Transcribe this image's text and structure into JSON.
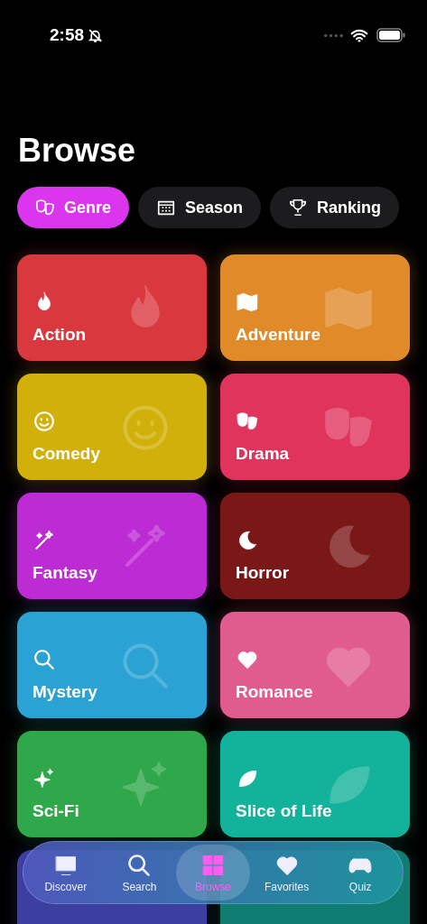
{
  "status_bar": {
    "time": "2:58"
  },
  "title": "Browse",
  "segments": [
    {
      "label": "Genre",
      "selected": true
    },
    {
      "label": "Season",
      "selected": false
    },
    {
      "label": "Ranking",
      "selected": false
    }
  ],
  "genres": [
    {
      "label": "Action",
      "color": "#d9383e"
    },
    {
      "label": "Adventure",
      "color": "#e08a2a"
    },
    {
      "label": "Comedy",
      "color": "#d2b00a"
    },
    {
      "label": "Drama",
      "color": "#e0345c"
    },
    {
      "label": "Fantasy",
      "color": "#bd2bd4"
    },
    {
      "label": "Horror",
      "color": "#7a1818"
    },
    {
      "label": "Mystery",
      "color": "#2aa3d4"
    },
    {
      "label": "Romance",
      "color": "#e05c8e"
    },
    {
      "label": "Sci-Fi",
      "color": "#2ea84a"
    },
    {
      "label": "Slice of Life",
      "color": "#12b39a"
    },
    {
      "color": "#3d3fa0"
    },
    {
      "color": "#0f7d72"
    }
  ],
  "tab_bar": [
    {
      "label": "Discover",
      "selected": false
    },
    {
      "label": "Search",
      "selected": false
    },
    {
      "label": "Browse",
      "selected": true
    },
    {
      "label": "Favorites",
      "selected": false
    },
    {
      "label": "Quiz",
      "selected": false
    }
  ]
}
